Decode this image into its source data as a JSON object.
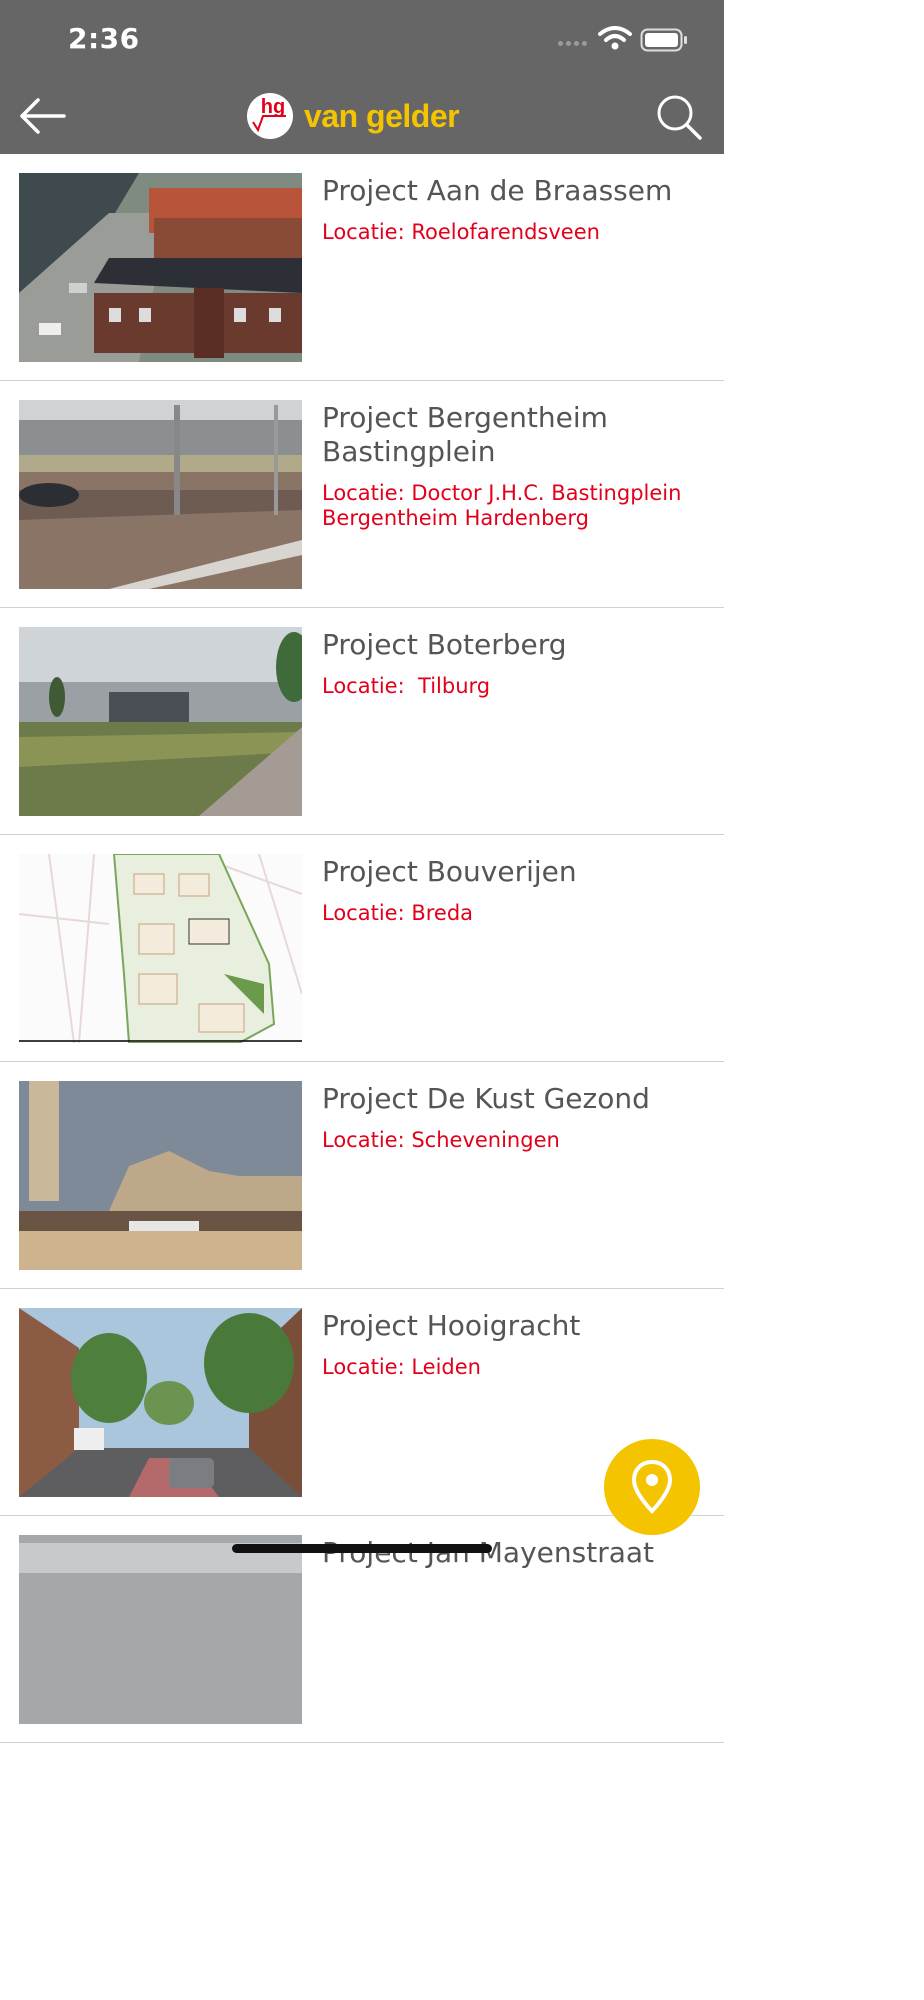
{
  "status_bar": {
    "time": "2:36"
  },
  "header": {
    "logo_mark": "hg",
    "logo_text": "van gelder"
  },
  "colors": {
    "header_bg": "#666666",
    "brand_yellow": "#f5c400",
    "location_red": "#e3001b"
  },
  "projects": [
    {
      "title": "Project Aan de Braassem",
      "location": "Locatie: Roelofarendsveen"
    },
    {
      "title": "Project Bergentheim Bastingplein",
      "location": "Locatie: Doctor J.H.C. Bastingplein Bergentheim Hardenberg"
    },
    {
      "title": "Project Boterberg",
      "location": "Locatie:  Tilburg"
    },
    {
      "title": "Project Bouverijen",
      "location": "Locatie: Breda"
    },
    {
      "title": "Project De Kust Gezond",
      "location": "Locatie: Scheveningen"
    },
    {
      "title": "Project Hooigracht",
      "location": "Locatie: Leiden"
    },
    {
      "title": "Project Jan Mayenstraat",
      "location": ""
    }
  ],
  "icons": {
    "back": "arrow-left-icon",
    "search": "search-icon",
    "fab": "map-pin-icon"
  }
}
